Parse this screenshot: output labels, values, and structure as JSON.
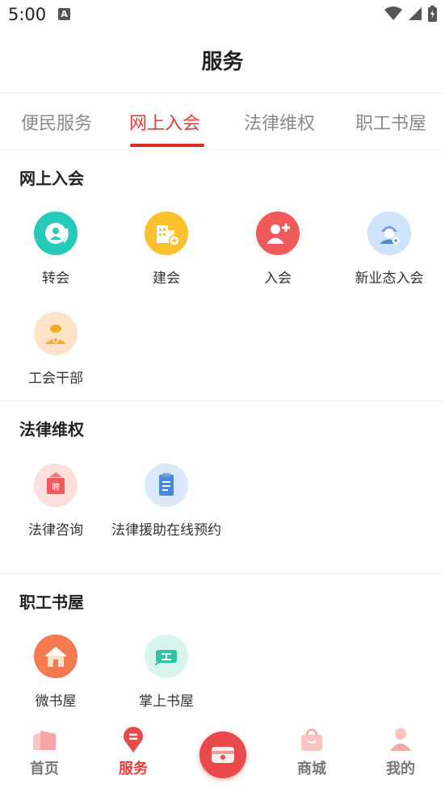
{
  "status_bar": {
    "time": "5:00",
    "notification_letter": "A"
  },
  "header": {
    "title": "服务"
  },
  "tabs": [
    {
      "label": "便民服务",
      "active": false
    },
    {
      "label": "网上入会",
      "active": true
    },
    {
      "label": "法律维权",
      "active": false
    },
    {
      "label": "职工书屋",
      "active": false
    }
  ],
  "sections": {
    "join": {
      "title": "网上入会",
      "items": [
        {
          "label": "转会",
          "icon": "transfer-member-icon",
          "color": "#27c9b8"
        },
        {
          "label": "建会",
          "icon": "building-icon",
          "color": "#fbc02d"
        },
        {
          "label": "入会",
          "icon": "add-person-icon",
          "color": "#f05a5a"
        },
        {
          "label": "新业态入会",
          "icon": "courier-icon",
          "color": "#cfe3fb"
        },
        {
          "label": "工会干部",
          "icon": "cadre-icon",
          "color": "#fde3c8"
        }
      ]
    },
    "legal": {
      "title": "法律维权",
      "items": [
        {
          "label": "法律咨询",
          "icon": "consult-icon",
          "color": "#fde0dd"
        },
        {
          "label": "法律援助在线预约",
          "icon": "document-icon",
          "color": "#dbe9fb"
        }
      ]
    },
    "books": {
      "title": "职工书屋",
      "items": [
        {
          "label": "微书屋",
          "icon": "house-icon",
          "color": "#f47a4f"
        },
        {
          "label": "掌上书屋",
          "icon": "book-icon",
          "color": "#d7f4ee"
        }
      ]
    }
  },
  "bottom_nav": {
    "items": [
      {
        "label": "首页",
        "icon": "home-icon",
        "active": false
      },
      {
        "label": "服务",
        "icon": "service-icon",
        "active": true
      },
      {
        "label": "商城",
        "icon": "shop-bag-icon",
        "active": false
      },
      {
        "label": "我的",
        "icon": "profile-icon",
        "active": false
      }
    ],
    "center_icon": "card-icon"
  },
  "colors": {
    "accent": "#e83a3a",
    "tab_underline": "#e02b2b",
    "inactive_text": "#8a8a8a"
  }
}
